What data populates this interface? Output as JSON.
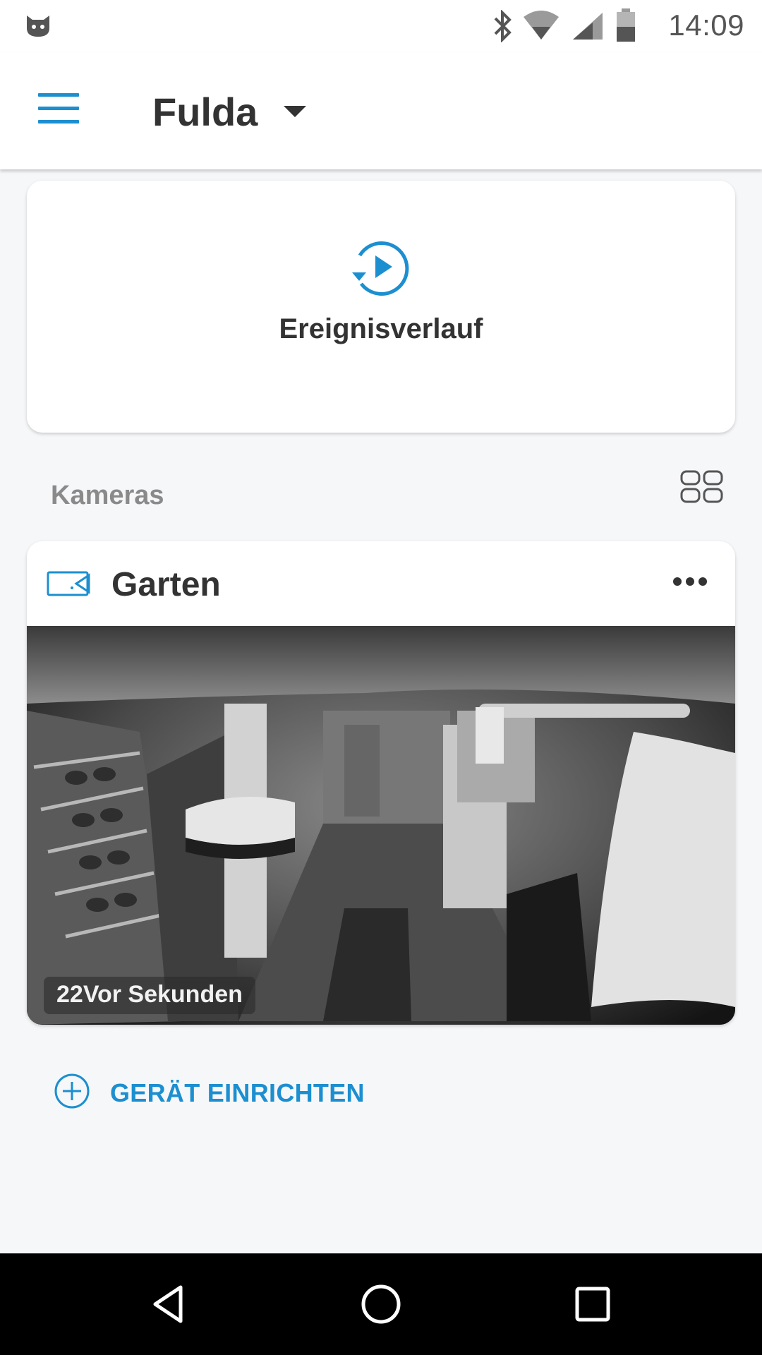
{
  "status_bar": {
    "time": "14:09",
    "icons": [
      "app-notification-icon",
      "bluetooth-icon",
      "wifi-icon",
      "cell-signal-icon",
      "battery-icon"
    ]
  },
  "app_bar": {
    "location": "Fulda",
    "menu_icon": "hamburger-menu-icon",
    "caret_icon": "dropdown-caret-icon"
  },
  "history": {
    "label": "Ereignisverlauf",
    "icon": "history-play-icon"
  },
  "cameras_section": {
    "title": "Kameras",
    "view_toggle_icon": "grid-view-icon"
  },
  "camera": {
    "name": "Garten",
    "icon": "video-camera-icon",
    "menu_icon": "more-options-icon",
    "timestamp": "22Vor Sekunden"
  },
  "setup": {
    "label": "GERÄT EINRICHTEN",
    "icon": "add-circle-icon"
  },
  "nav_bar": {
    "icons": [
      "back-icon",
      "home-icon",
      "recents-icon"
    ]
  },
  "colors": {
    "accent": "#1c8fd0",
    "background": "#f6f7f9",
    "card": "#ffffff",
    "text_dark": "#333333",
    "text_muted": "#8a8a8a"
  }
}
